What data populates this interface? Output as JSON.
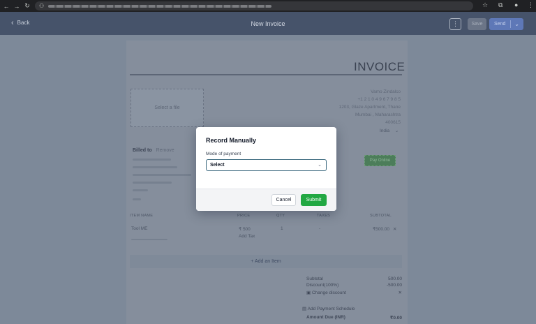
{
  "browser": {
    "icons": [
      "back-arrow-icon",
      "forward-arrow-icon",
      "reload-icon",
      "site-info-icon",
      "star-icon",
      "extensions-icon",
      "profile-icon",
      "menu-dots-icon"
    ]
  },
  "header": {
    "back_label": "Back",
    "title": "New Invoice",
    "more_label": "⋮",
    "save_label": "Save",
    "send_label": "Send"
  },
  "invoice": {
    "heading": "INVOICE",
    "logo_placeholder": "Select a file",
    "company": {
      "name": "Vamo Zindalco",
      "phone": "+1 2 1 0 4 9 6 7 9 8 5",
      "address": "1203, Glaze Apartment, Thane",
      "city": "Mumbai , Maharashtra",
      "postal": "400615",
      "country": "India"
    },
    "billed_to_label": "Billed to",
    "remove_label": "Remove",
    "pay_online_label": "Pay Online",
    "table": {
      "columns": [
        "ITEM NAME",
        "PRICE",
        "QTY",
        "TAXES",
        "SUBTOTAL"
      ],
      "rows": [
        {
          "name": "Tool ME",
          "price": "₹ 500",
          "add_tax": "Add Tax",
          "qty": "1",
          "taxes": "-",
          "subtotal": "₹500.00"
        }
      ]
    },
    "add_item_label": "+ Add an Item",
    "summary": {
      "subtotal_label": "Subtotal",
      "subtotal_value": "500.00",
      "discount_label": "Discount(100%)",
      "discount_value": "-500.00",
      "change_discount_label": "Change discount",
      "payment_schedule_label": "Add Payment Schedule",
      "amount_due_label": "Amount Due (INR)",
      "amount_due_value": "₹0.00"
    }
  },
  "modal": {
    "title": "Record Manually",
    "field_label": "Mode of payment",
    "select_value": "Select",
    "cancel_label": "Cancel",
    "submit_label": "Submit"
  },
  "colors": {
    "overlay": "#7d8999",
    "submit": "#22a843",
    "select_border": "#3e6b80"
  }
}
